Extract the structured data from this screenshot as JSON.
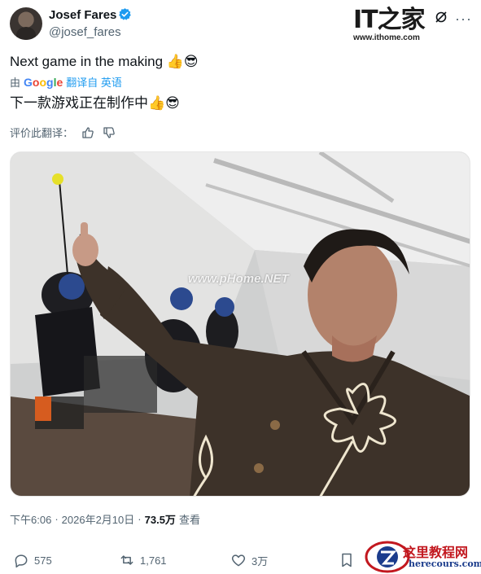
{
  "author": {
    "name": "Josef Fares",
    "handle": "@josef_fares",
    "verified": true
  },
  "source_logo": {
    "brand_chars": "IT之家",
    "url": "www.ithome.com"
  },
  "tweet": {
    "text": "Next game in the making 👍😎",
    "translated_prefix": "由",
    "translated_engine": "Google",
    "translated_link": "翻译自 英语",
    "translated_text": "下一款游戏正在制作中👍😎",
    "rate_label": "评价此翻译："
  },
  "photo": {
    "watermark": "www.pHome.NET"
  },
  "meta": {
    "time": "下午6:06",
    "separator": "·",
    "date": "2026年2月10日",
    "views_count": "73.5万",
    "views_label": "查看"
  },
  "actions": {
    "replies": "575",
    "reposts": "1,761",
    "likes": "3万"
  },
  "corner_logo": {
    "title": "这里教程网",
    "url": "herecours.com"
  },
  "colors": {
    "accent": "#1d9bf0",
    "muted": "#536471",
    "verified": "#1d9bf0"
  }
}
